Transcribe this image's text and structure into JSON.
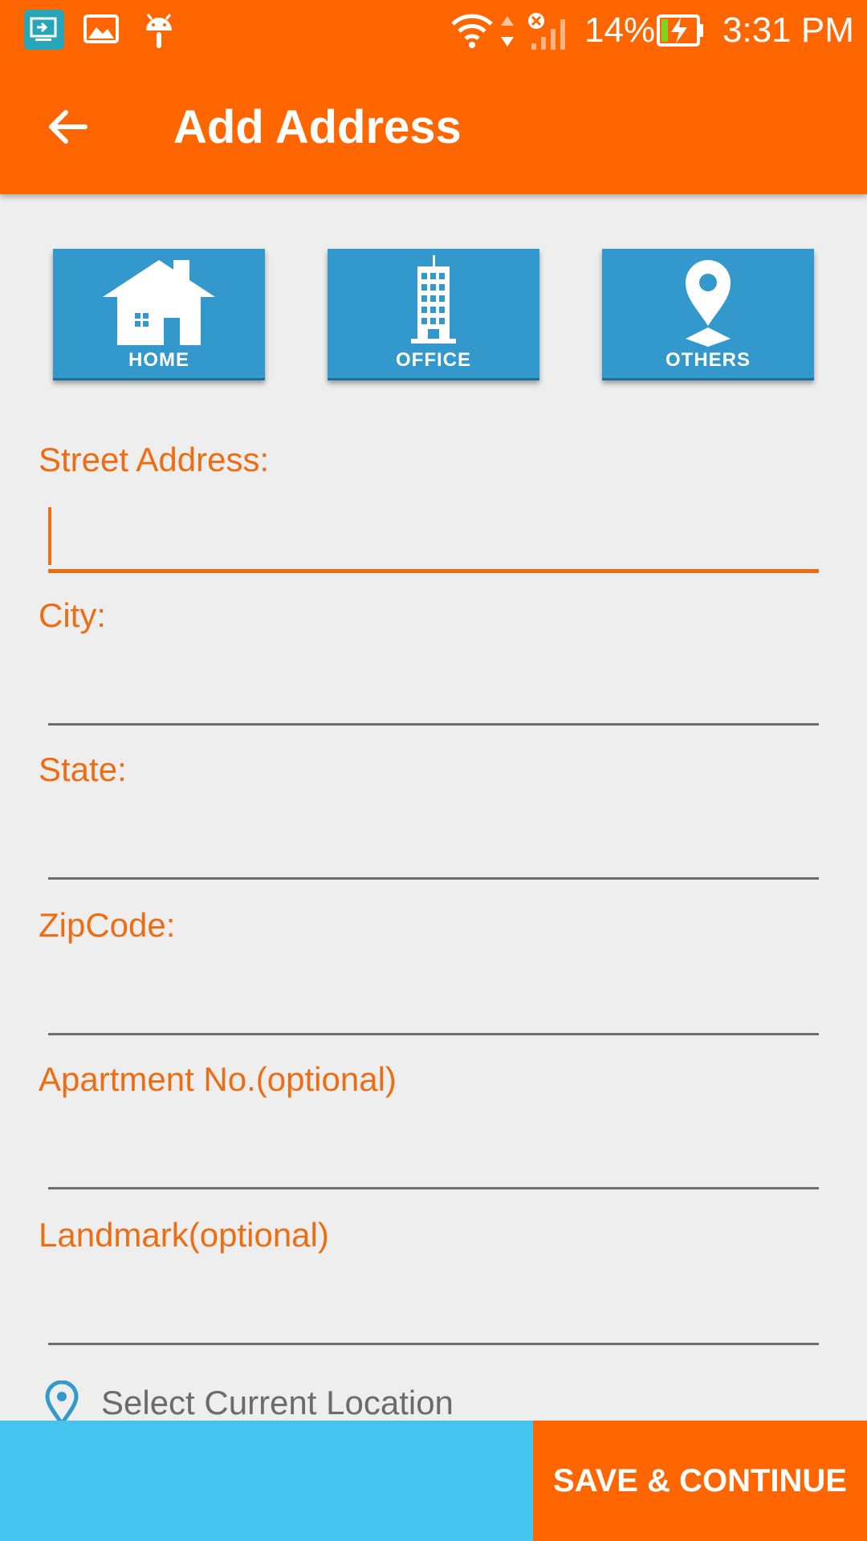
{
  "status_bar": {
    "battery": "14%",
    "time": "3:31 PM",
    "icons": [
      "screen-mirror-icon",
      "image-icon",
      "android-icon",
      "wifi-icon",
      "data-arrows-icon",
      "signal-icon",
      "battery-charging-icon"
    ]
  },
  "app_bar": {
    "title": "Add Address",
    "back_icon": "arrow-back-icon"
  },
  "address_types": [
    {
      "label": "HOME",
      "icon": "house-icon"
    },
    {
      "label": "OFFICE",
      "icon": "building-icon"
    },
    {
      "label": "OTHERS",
      "icon": "map-pin-icon"
    }
  ],
  "form": {
    "street_label": "Street Address:",
    "street_value": "",
    "city_label": "City:",
    "city_value": "",
    "state_label": "State:",
    "state_value": "",
    "zip_label": "ZipCode:",
    "zip_value": "",
    "apartment_label": "Apartment No.(optional)",
    "apartment_value": "",
    "landmark_label": "Landmark(optional)",
    "landmark_value": ""
  },
  "location": {
    "label": "Select Current Location",
    "icon": "location-pin-icon"
  },
  "footer": {
    "save_label": "SAVE & CONTINUE"
  },
  "colors": {
    "primary": "#ff6600",
    "label": "#ee6d12",
    "type_button": "#3399cc",
    "footer_left": "#45c4f0",
    "background": "#eeeeee"
  }
}
